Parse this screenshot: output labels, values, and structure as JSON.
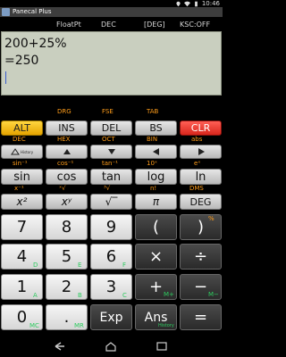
{
  "status": {
    "time": "10:46"
  },
  "window": {
    "app_title": "Panecal Plus"
  },
  "modes": {
    "display_format": "FloatPt",
    "base": "DEC",
    "angle": "[DEG]",
    "ksc": "KSC:OFF"
  },
  "display": {
    "expression": "200+25%",
    "result": "=250"
  },
  "row_labels": {
    "r1": [
      "DRG",
      "FSE",
      "TAB"
    ],
    "r2": [
      "DEC",
      "HEX",
      "OCT",
      "BIN",
      "abs"
    ],
    "r3": [
      "sin⁻¹",
      "cos⁻¹",
      "tan⁻¹",
      "10ˣ",
      "eˣ"
    ],
    "r4": [
      "x⁻¹",
      "ˣ√",
      "³√",
      "n!",
      "DMS"
    ]
  },
  "keys": {
    "alt": "ALT",
    "ins": "INS",
    "del": "DEL",
    "bs": "BS",
    "clr": "CLR",
    "sin": "sin",
    "cos": "cos",
    "tan": "tan",
    "log": "log",
    "ln": "ln",
    "x2": "x²",
    "xy": "xʸ",
    "sqrt": "√‾",
    "pi": "π",
    "deg": "DEG",
    "n7": "7",
    "n8": "8",
    "n9": "9",
    "lparen": "(",
    "rparen": ")",
    "n4": "4",
    "n5": "5",
    "n6": "6",
    "times": "×",
    "divide": "÷",
    "n1": "1",
    "n2": "2",
    "n3": "3",
    "plus": "+",
    "minus": "−",
    "n0": "0",
    "dot": ".",
    "exp": "Exp",
    "ans": "Ans",
    "equals": "="
  },
  "sublabels": {
    "history": "History",
    "pct": "%",
    "n4": "D",
    "n5": "E",
    "n6": "F",
    "n1": "A",
    "n2": "B",
    "n3": "C",
    "n0": "MC",
    "dot": "MR",
    "ans": "History",
    "plus": "M+",
    "minus": "M−"
  }
}
